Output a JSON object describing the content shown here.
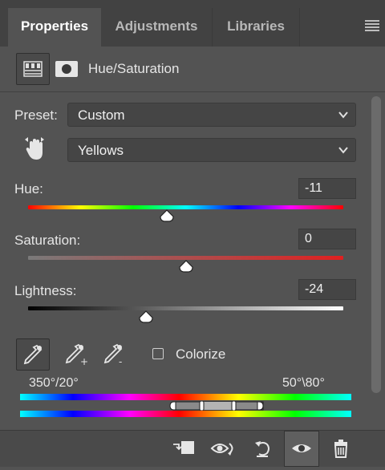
{
  "tabs": [
    {
      "label": "Properties",
      "active": true
    },
    {
      "label": "Adjustments",
      "active": false
    },
    {
      "label": "Libraries",
      "active": false
    }
  ],
  "panel_menu_icon": "hamburger-icon",
  "header": {
    "title": "Hue/Saturation",
    "icons": [
      "hue-saturation-adjustment-icon",
      "layer-mask-icon"
    ]
  },
  "preset": {
    "label": "Preset:",
    "value": "Custom"
  },
  "channel": {
    "icon": "on-image-adjustment-hand-icon",
    "value": "Yellows"
  },
  "sliders": {
    "hue": {
      "label": "Hue:",
      "value": "-11",
      "position": 0.44
    },
    "saturation": {
      "label": "Saturation:",
      "value": "0",
      "position": 0.5
    },
    "lightness": {
      "label": "Lightness:",
      "value": "-24",
      "position": 0.375
    }
  },
  "tools": {
    "items": [
      "eyedropper-icon",
      "add-to-sample-eyedropper-icon",
      "subtract-from-sample-eyedropper-icon"
    ],
    "colorize_label": "Colorize",
    "colorize_checked": false
  },
  "range": {
    "left": "350°/20°",
    "right": "50°\\80°"
  },
  "bottom_toolbar": [
    "clip-to-layer-icon",
    "view-previous-state-icon",
    "reset-to-defaults-icon",
    "toggle-visibility-icon",
    "delete-adjustment-icon"
  ],
  "colors": {
    "panel_bg": "#535353",
    "tabbar_bg": "#424242",
    "field_bg": "#454545",
    "text": "#e6e6e6"
  }
}
